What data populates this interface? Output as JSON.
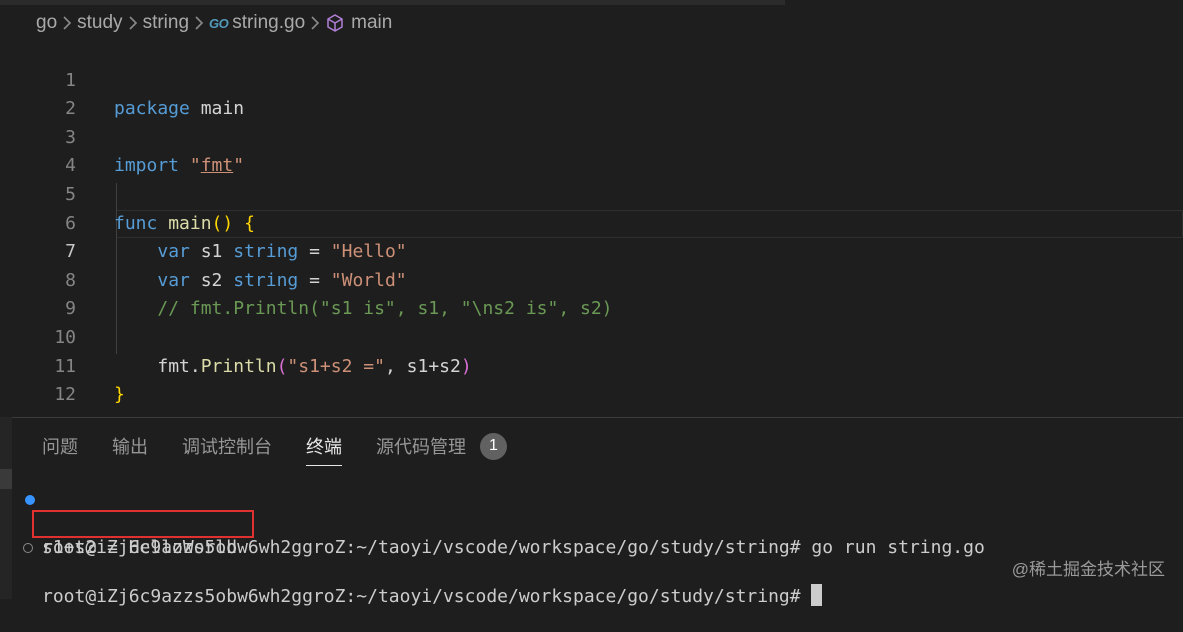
{
  "breadcrumb": {
    "items": [
      "go",
      "study",
      "string",
      "string.go",
      "main"
    ],
    "go_icon_text": "GO"
  },
  "editor": {
    "lines": [
      {
        "n": "1"
      },
      {
        "n": "2"
      },
      {
        "n": "3"
      },
      {
        "n": "4"
      },
      {
        "n": "5"
      },
      {
        "n": "6"
      },
      {
        "n": "7"
      },
      {
        "n": "8"
      },
      {
        "n": "9"
      },
      {
        "n": "10"
      },
      {
        "n": "11"
      },
      {
        "n": "12"
      }
    ],
    "active_line": "7",
    "code": {
      "l1_kw": "package",
      "l1_rest": " main",
      "l3_kw": "import",
      "l3_q1": " \"",
      "l3_pkg": "fmt",
      "l3_q2": "\"",
      "l5_kw": "func",
      "l5_name": " main",
      "l5_paren": "()",
      "l5_brace": " {",
      "l6_kw": "var",
      "l6_var": " s1 ",
      "l6_type": "string",
      "l6_eq": " = ",
      "l6_str": "\"Hello\"",
      "l7_kw": "var",
      "l7_var": " s2 ",
      "l7_type": "string",
      "l7_eq": " = ",
      "l7_str": "\"World\"",
      "l8_comment": "// fmt.Println(\"s1 is\", s1, \"\\ns2 is\", s2)",
      "l10_pkg": "fmt.",
      "l10_fn": "Println",
      "l10_open": "(",
      "l10_str": "\"s1+s2 =\"",
      "l10_rest": ", s1+s2",
      "l10_close": ")",
      "l11_brace": "}"
    }
  },
  "panel": {
    "tabs": [
      "问题",
      "输出",
      "调试控制台",
      "终端",
      "源代码管理"
    ],
    "active_tab": "终端",
    "scm_badge": "1"
  },
  "terminal": {
    "line1": "root@iZj6c9azzs5obw6wh2ggroZ:~/taoyi/vscode/workspace/go/study/string# go run string.go",
    "line2": "s1+s2 = HelloWorld",
    "line3": "root@iZj6c9azzs5obw6wh2ggroZ:~/taoyi/vscode/workspace/go/study/string# "
  },
  "watermark": "@稀土掘金技术社区",
  "colors": {
    "background": "#1e1e1e",
    "keyword": "#569cd6",
    "function": "#dcdcaa",
    "type": "#4ec9b0",
    "string": "#ce9178",
    "comment": "#6a9955",
    "highlight_box": "#e03131"
  }
}
